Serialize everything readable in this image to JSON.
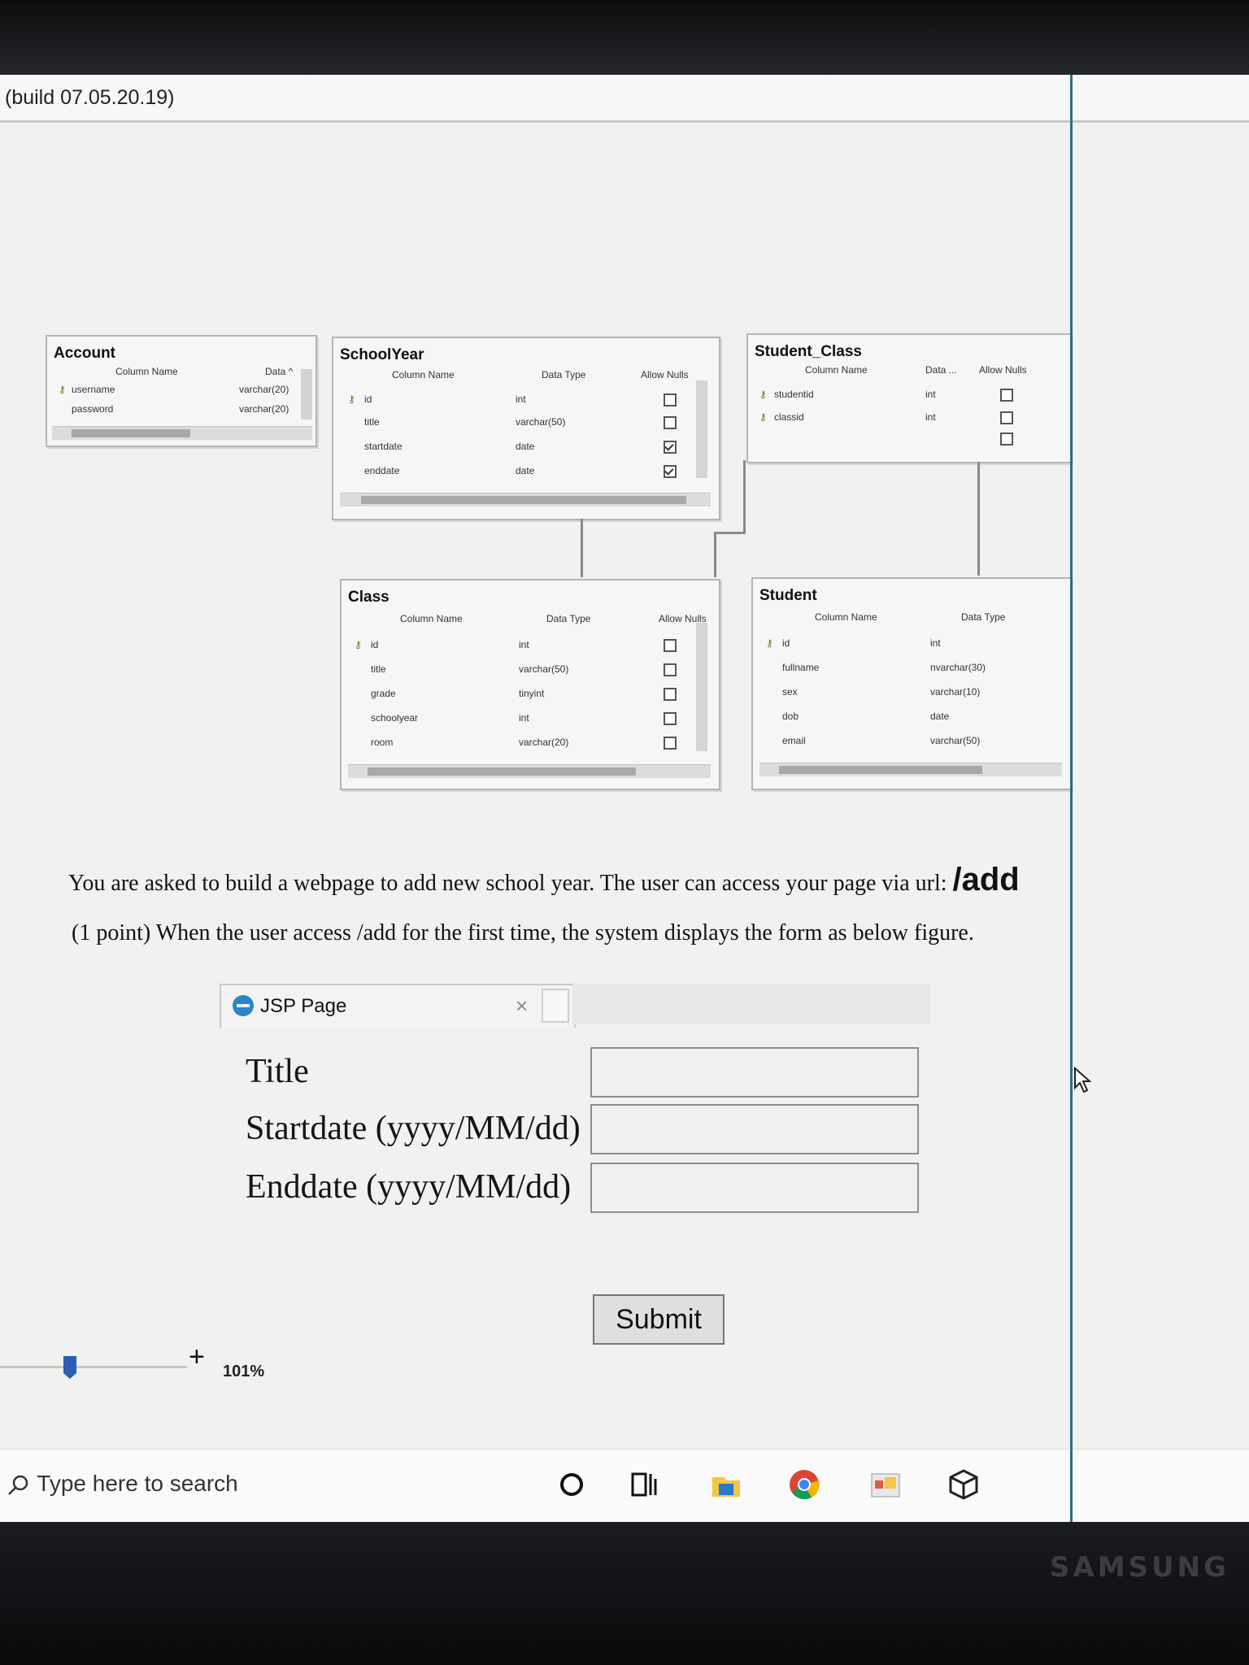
{
  "window": {
    "build_text": "(build 07.05.20.19)"
  },
  "tables": {
    "account": {
      "title": "Account",
      "headers": [
        "Column Name",
        "Data ^"
      ],
      "rows": [
        {
          "name": "username",
          "type": "varchar(20)",
          "key": true
        },
        {
          "name": "password",
          "type": "varchar(20)",
          "key": false
        }
      ]
    },
    "schoolyear": {
      "title": "SchoolYear",
      "headers": [
        "Column Name",
        "Data Type",
        "Allow Nulls"
      ],
      "rows": [
        {
          "name": "id",
          "type": "int",
          "key": true,
          "nulls": false
        },
        {
          "name": "title",
          "type": "varchar(50)",
          "key": false,
          "nulls": false
        },
        {
          "name": "startdate",
          "type": "date",
          "key": false,
          "nulls": true
        },
        {
          "name": "enddate",
          "type": "date",
          "key": false,
          "nulls": true
        }
      ]
    },
    "student_class": {
      "title": "Student_Class",
      "headers": [
        "Column Name",
        "Data ...",
        "Allow Nulls"
      ],
      "rows": [
        {
          "name": "studentid",
          "type": "int",
          "key": true,
          "nulls": false
        },
        {
          "name": "classid",
          "type": "int",
          "key": true,
          "nulls": false
        }
      ]
    },
    "class": {
      "title": "Class",
      "headers": [
        "Column Name",
        "Data Type",
        "Allow Nulls"
      ],
      "rows": [
        {
          "name": "id",
          "type": "int",
          "key": true,
          "nulls": false
        },
        {
          "name": "title",
          "type": "varchar(50)",
          "key": false,
          "nulls": false
        },
        {
          "name": "grade",
          "type": "tinyint",
          "key": false,
          "nulls": false
        },
        {
          "name": "schoolyear",
          "type": "int",
          "key": false,
          "nulls": false
        },
        {
          "name": "room",
          "type": "varchar(20)",
          "key": false,
          "nulls": false
        }
      ]
    },
    "student": {
      "title": "Student",
      "headers": [
        "Column Name",
        "Data Type"
      ],
      "rows": [
        {
          "name": "id",
          "type": "int",
          "key": true
        },
        {
          "name": "fullname",
          "type": "nvarchar(30)",
          "key": false
        },
        {
          "name": "sex",
          "type": "varchar(10)",
          "key": false
        },
        {
          "name": "dob",
          "type": "date",
          "key": false
        },
        {
          "name": "email",
          "type": "varchar(50)",
          "key": false
        }
      ]
    }
  },
  "question": {
    "intro": "You are asked to build a webpage to add new school year. The user can access your page via url:",
    "url": "/add",
    "part1": "(1 point) When the user access /add for the first time, the system displays the form as below figure."
  },
  "browser": {
    "tab_title": "JSP Page",
    "close_glyph": "×"
  },
  "form": {
    "title_label": "Title",
    "startdate_label": "Startdate (yyyy/MM/dd)",
    "enddate_label": "Enddate (yyyy/MM/dd)",
    "submit_label": "Submit",
    "title_value": "",
    "startdate_value": "",
    "enddate_value": ""
  },
  "zoom": {
    "plus": "+",
    "value": "101%"
  },
  "taskbar": {
    "search_placeholder": "Type here to search",
    "icons": [
      "cortana-icon",
      "task-view-icon",
      "file-explorer-icon",
      "chrome-icon",
      "store-icon",
      "app-cube-icon"
    ]
  },
  "device": {
    "brand": "SAMSUNG"
  },
  "colors": {
    "accent_line": "#2a6f86",
    "ie_blue": "#2a86c9"
  }
}
